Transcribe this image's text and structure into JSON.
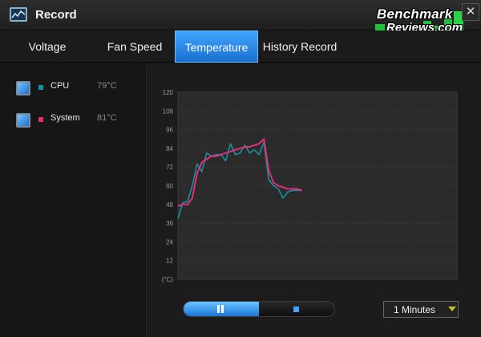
{
  "window": {
    "title": "Record",
    "close_glyph": "✕"
  },
  "watermark": {
    "line1": "Benchmark",
    "line2": "Reviews.com"
  },
  "tabs": [
    {
      "label": "Voltage",
      "active": false
    },
    {
      "label": "Fan Speed",
      "active": false
    },
    {
      "label": "Temperature",
      "active": true
    },
    {
      "label": "History Record",
      "active": false
    }
  ],
  "sensors": [
    {
      "name": "CPU",
      "value": "79°C",
      "color": "#1a8fa0",
      "checked": true
    },
    {
      "name": "System",
      "value": "81°C",
      "color": "#e0307a",
      "checked": true
    }
  ],
  "playback": {
    "progress": 0.5,
    "pause_icon": "pause-icon",
    "stop_icon": "stop-icon"
  },
  "interval": {
    "selected": "1 Minutes"
  },
  "colors": {
    "accent": "#2a8cf0",
    "cpu_line": "#1a8fa0",
    "system_line": "#e0307a"
  },
  "chart_data": {
    "type": "line",
    "title": "",
    "xlabel": "",
    "ylabel": "(°C)",
    "ylim": [
      0,
      120
    ],
    "yticks": [
      120,
      108,
      96,
      84,
      72,
      60,
      48,
      36,
      24,
      12
    ],
    "grid": true,
    "series": [
      {
        "name": "CPU",
        "color": "#1a8fa0",
        "x": [
          0,
          1,
          2,
          3,
          4,
          5,
          6,
          7,
          8,
          9,
          10,
          11,
          12,
          13,
          14,
          15,
          16,
          17,
          18,
          19,
          20,
          21,
          22,
          23,
          24,
          25,
          26
        ],
        "values": [
          39,
          49,
          50,
          60,
          74,
          69,
          81,
          79,
          80,
          80,
          76,
          87,
          80,
          81,
          86,
          81,
          83,
          80,
          88,
          64,
          60,
          58,
          52,
          56,
          57,
          57,
          57
        ]
      },
      {
        "name": "System",
        "color": "#e0307a",
        "x": [
          0,
          1,
          2,
          3,
          4,
          5,
          6,
          7,
          8,
          9,
          10,
          11,
          12,
          13,
          14,
          15,
          16,
          17,
          18,
          19,
          20,
          21,
          22,
          23,
          24,
          25,
          26
        ],
        "values": [
          47,
          48,
          48,
          52,
          68,
          75,
          77,
          79,
          79,
          80,
          81,
          82,
          83,
          84,
          85,
          85,
          86,
          87,
          90,
          70,
          62,
          60,
          59,
          58,
          58,
          58,
          57
        ]
      }
    ]
  }
}
